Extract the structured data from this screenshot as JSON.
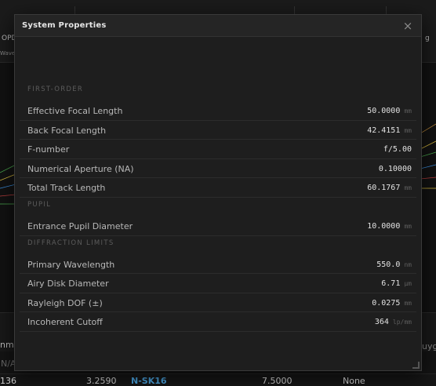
{
  "background": {
    "toolbar": {
      "item_opd": "OPD",
      "item_wave": "Wave",
      "item_g": "g"
    },
    "table": {
      "header_left": "nm]",
      "header_right": "uyg",
      "row_na": "N/A",
      "row": {
        "index": "136",
        "thickness": "3.2590",
        "glass": "N-SK16",
        "semi_diameter": "7.5000",
        "conic": "None"
      }
    }
  },
  "modal": {
    "title": "System Properties",
    "close_label": "×",
    "sections": [
      {
        "heading": "FIRST-ORDER",
        "rows": [
          {
            "label": "Effective Focal Length",
            "value": "50.0000",
            "unit": "mm"
          },
          {
            "label": "Back Focal Length",
            "value": "42.4151",
            "unit": "mm"
          },
          {
            "label": "F-number",
            "value": "f/5.00",
            "unit": ""
          },
          {
            "label": "Numerical Aperture (NA)",
            "value": "0.10000",
            "unit": ""
          },
          {
            "label": "Total Track Length",
            "value": "60.1767",
            "unit": "mm"
          }
        ]
      },
      {
        "heading": "PUPIL",
        "rows": [
          {
            "label": "Entrance Pupil Diameter",
            "value": "10.0000",
            "unit": "mm"
          }
        ]
      },
      {
        "heading": "DIFFRACTION LIMITS",
        "rows": [
          {
            "label": "Primary Wavelength",
            "value": "550.0",
            "unit": "nm"
          },
          {
            "label": "Airy Disk Diameter",
            "value": "6.71",
            "unit": "µm"
          },
          {
            "label": "Rayleigh DOF (±)",
            "value": "0.0275",
            "unit": "mm"
          },
          {
            "label": "Incoherent Cutoff",
            "value": "364",
            "unit": "lp/mm"
          }
        ]
      }
    ]
  }
}
